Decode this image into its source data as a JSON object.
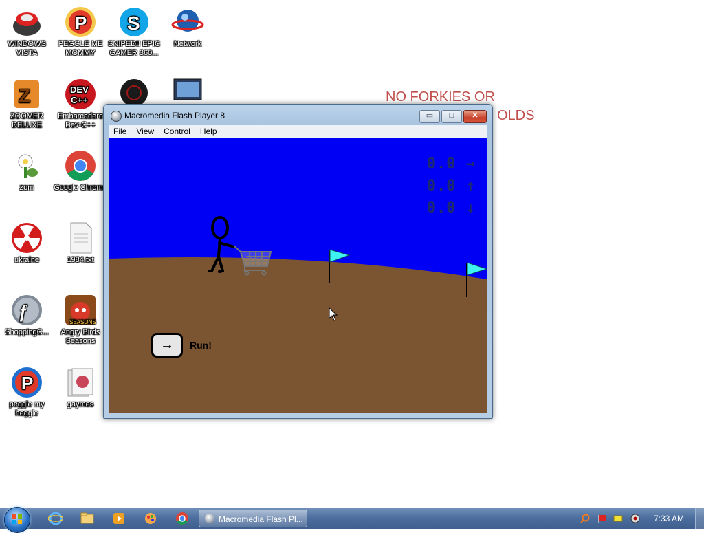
{
  "desktop": {
    "icons": [
      {
        "label": "WINDOWS VISTA",
        "icon": "toaster-bowl-icon"
      },
      {
        "label": "PEGGLE ME MOMMY",
        "icon": "peggle-icon"
      },
      {
        "label": "SNIPED!! EPIC GAMER 360...",
        "icon": "skype-icon"
      },
      {
        "label": "Network",
        "icon": "network-globe-icon"
      },
      {
        "label": "ZOOMER DELUXE",
        "icon": "zoomer-icon"
      },
      {
        "label": "Embarcadero Dev-C++",
        "icon": "devcpp-icon"
      },
      {
        "label": "zom",
        "icon": "plants-zombies-icon"
      },
      {
        "label": "Google Chrome",
        "icon": "chrome-icon"
      },
      {
        "label": "ukraine",
        "icon": "radiation-icon"
      },
      {
        "label": "1984.txt",
        "icon": "text-file-icon"
      },
      {
        "label": "ShoppingC...",
        "icon": "flash-icon"
      },
      {
        "label": "Angry Birds Seasons",
        "icon": "angry-birds-icon"
      },
      {
        "label": "peggle my heggle",
        "icon": "peggle-icon"
      },
      {
        "label": "gaymes",
        "icon": "folder-icon"
      }
    ],
    "background_text_line1": "NO FORKIES OR",
    "background_text_line2": "OLDS"
  },
  "window": {
    "title": "Macromedia Flash Player 8",
    "menu": [
      "File",
      "View",
      "Control",
      "Help"
    ],
    "buttons": {
      "minimize": "▭",
      "maximize": "□",
      "close": "✕"
    }
  },
  "game": {
    "hud": [
      "0.0 →",
      "0.0 ↑",
      "0.0 ↓"
    ],
    "run_label": "Run!",
    "run_arrow": "→",
    "sky_color": "#0000f5",
    "ground_color": "#7b5532",
    "flag_color": "#3ff2f2"
  },
  "taskbar": {
    "active_task": "Macromedia Flash Pl...",
    "clock": "7:33 AM"
  }
}
